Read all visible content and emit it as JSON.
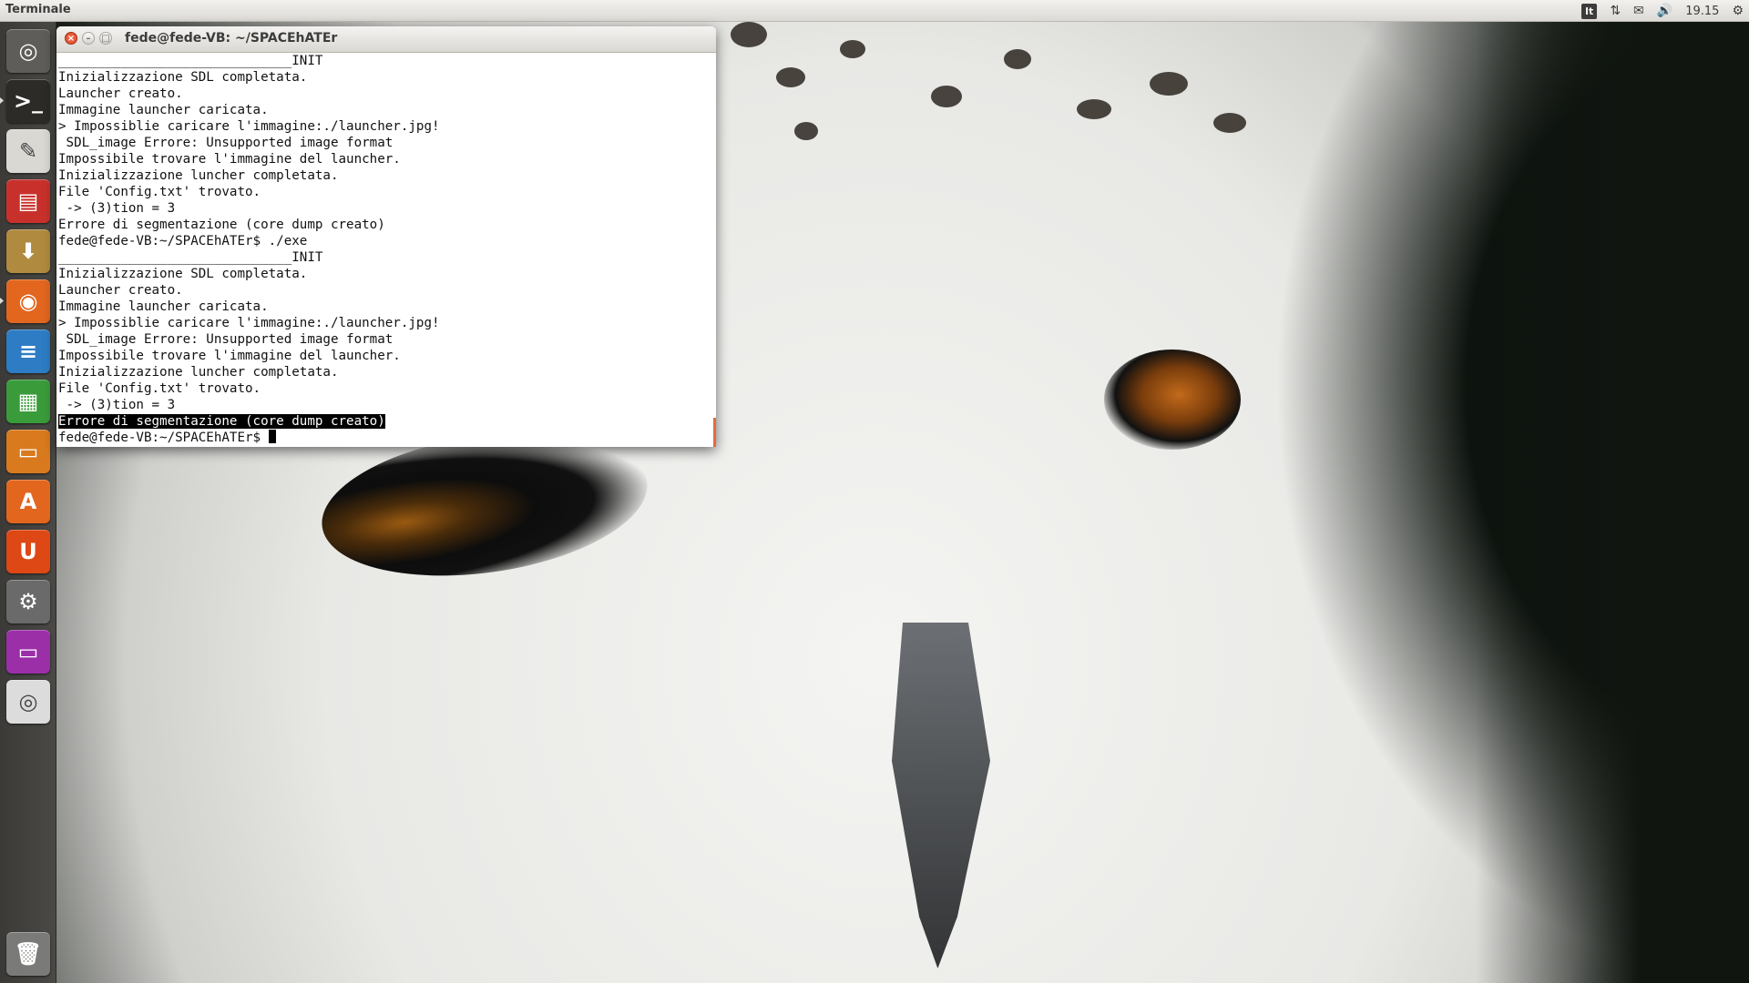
{
  "top_panel": {
    "app_title": "Terminale",
    "keyboard_layout": "It",
    "network_icon": "network-arrows-icon",
    "mail_icon": "mail-icon",
    "volume_icon": "volume-icon",
    "clock": "19.15",
    "settings_icon": "gear-icon"
  },
  "launcher": {
    "items": [
      {
        "name": "dash-home-icon",
        "glyph": "◎",
        "bg": "#5e5d59"
      },
      {
        "name": "terminal-icon",
        "glyph": ">_",
        "bg": "#2c2b28"
      },
      {
        "name": "text-editor-icon",
        "glyph": "✎",
        "bg": "#d9d8d3"
      },
      {
        "name": "file-manager-icon",
        "glyph": "▤",
        "bg": "#c8312b"
      },
      {
        "name": "archive-manager-icon",
        "glyph": "⬇",
        "bg": "#b08a3e"
      },
      {
        "name": "firefox-icon",
        "glyph": "◉",
        "bg": "#e2661e"
      },
      {
        "name": "writer-icon",
        "glyph": "≡",
        "bg": "#2d7cc4"
      },
      {
        "name": "calc-icon",
        "glyph": "▦",
        "bg": "#3a9b3a"
      },
      {
        "name": "impress-icon",
        "glyph": "▭",
        "bg": "#d97a1e"
      },
      {
        "name": "software-center-icon",
        "glyph": "A",
        "bg": "#e2661e"
      },
      {
        "name": "ubuntu-one-icon",
        "glyph": "U",
        "bg": "#dd4814"
      },
      {
        "name": "system-settings-icon",
        "glyph": "⚙",
        "bg": "#6a6a6a"
      },
      {
        "name": "workspace-switcher-icon",
        "glyph": "▭",
        "bg": "#9b2fa8"
      },
      {
        "name": "disc-icon",
        "glyph": "◎",
        "bg": "#dcdcdc"
      },
      {
        "name": "trash-icon",
        "glyph": "🗑",
        "bg": "#7a7a78"
      }
    ]
  },
  "terminal": {
    "title": "fede@fede-VB: ~/SPACEhATEr",
    "lines": [
      "______________________________INIT",
      "Inizializzazione SDL completata.",
      "Launcher creato.",
      "Immagine launcher caricata.",
      "> Impossiblie caricare l'immagine:./launcher.jpg!",
      " SDL_image Errore: Unsupported image format",
      "Impossibile trovare l'immagine del launcher.",
      "Inizializzazione luncher completata.",
      "File 'Config.txt' trovato.",
      " -> (3)tion = 3",
      "Errore di segmentazione (core dump creato)",
      "fede@fede-VB:~/SPACEhATEr$ ./exe",
      "______________________________INIT",
      "Inizializzazione SDL completata.",
      "Launcher creato.",
      "Immagine launcher caricata.",
      "> Impossiblie caricare l'immagine:./launcher.jpg!",
      " SDL_image Errore: Unsupported image format",
      "Impossibile trovare l'immagine del launcher.",
      "Inizializzazione luncher completata.",
      "File 'Config.txt' trovato.",
      " -> (3)tion = 3"
    ],
    "highlighted_line": "Errore di segmentazione (core dump creato)",
    "prompt": "fede@fede-VB:~/SPACEhATEr$ "
  }
}
